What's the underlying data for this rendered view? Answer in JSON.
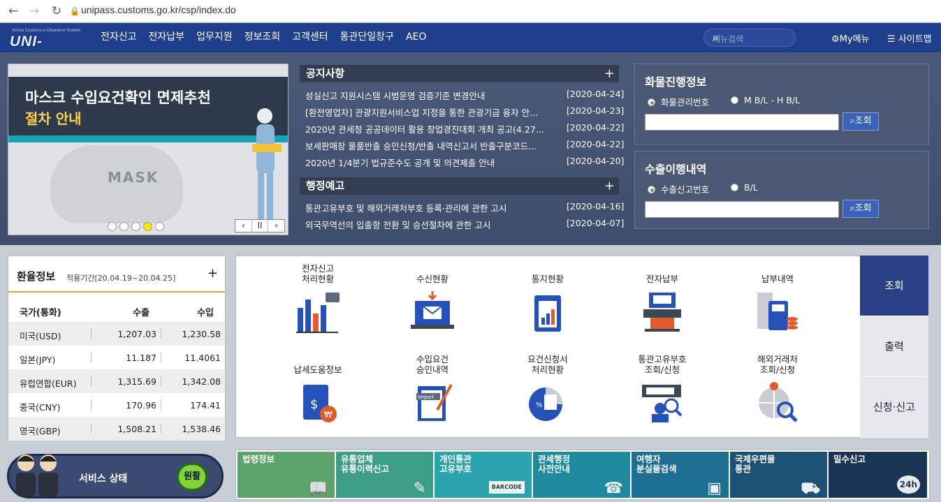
{
  "browser": {
    "url": "unipass.customs.go.kr/csp/index.do"
  },
  "header": {
    "logo_small": "Korea Customs e-Clearance System",
    "logo_text": "UNI-PASS",
    "nav": [
      "전자신고",
      "전자납부",
      "업무지원",
      "정보조회",
      "고객센터",
      "통관단일창구",
      "AEO"
    ],
    "search_placeholder": "메뉴검색",
    "mymenu": "My메뉴",
    "sitemap": "사이트맵"
  },
  "banner": {
    "line1": "마스크 수입요건확인 면제추천",
    "line2": "절차 안내",
    "mask_text": "MASK",
    "controls": [
      "‹",
      "II",
      "›"
    ]
  },
  "notices": {
    "title": "공지사항",
    "items": [
      {
        "text": "성실신고 지원시스템 시범운영 검증기준 변경안내",
        "date": "[2020-04-24]"
      },
      {
        "text": "[환전영업자] 관광지원서비스업 지정을 통한 관광기금 융자 안...",
        "date": "[2020-04-23]"
      },
      {
        "text": "2020년 관세청 공공데이터 활용 창업경진대회 개최 공고(4.27...",
        "date": "[2020-04-22]"
      },
      {
        "text": "보세판매장 물품반출 승인신청/반출 내역신고서 반출구분코드...",
        "date": "[2020-04-22]"
      },
      {
        "text": "2020년 1/4분기 법규준수도 공개 및 의견제출 안내",
        "date": "[2020-04-20]"
      }
    ]
  },
  "admin_notice": {
    "title": "행정예고",
    "items": [
      {
        "text": "통관고유부호 및 해외거래처부호 등록·관리에 관한 고시",
        "date": "[2020-04-16]"
      },
      {
        "text": "외국무역선의 입출항 전환 및 승선절차에 관한 고시",
        "date": "[2020-04-07]"
      }
    ]
  },
  "cargo": {
    "title": "화물진행정보",
    "options": [
      "화물관리번호",
      "M B/L - H B/L"
    ],
    "button": "조회"
  },
  "export": {
    "title": "수출이행내역",
    "options": [
      "수출신고번호",
      "B/L"
    ],
    "button": "조회"
  },
  "exchange": {
    "title": "환율정보",
    "period": "적용기간[20.04.19~20.04.25]",
    "headers": [
      "국가(통화)",
      "수출",
      "수입"
    ],
    "rows": [
      [
        "미국(USD)",
        "1,207.03",
        "1,230.58"
      ],
      [
        "일본(JPY)",
        "11.187",
        "11.4061"
      ],
      [
        "유럽연합(EUR)",
        "1,315.69",
        "1,342.08"
      ],
      [
        "중국(CNY)",
        "170.96",
        "174.41"
      ],
      [
        "영국(GBP)",
        "1,508.21",
        "1,538.46"
      ]
    ]
  },
  "services": [
    {
      "label": "전자신고\n처리현황",
      "icon": "bar-chart-icon"
    },
    {
      "label": "수신현황",
      "icon": "laptop-mail-icon"
    },
    {
      "label": "통지현황",
      "icon": "clipboard-chart-icon"
    },
    {
      "label": "전자납부",
      "icon": "atm-icon"
    },
    {
      "label": "납부내역",
      "icon": "receipt-calculator-icon"
    },
    {
      "label": "납세도움정보",
      "icon": "tax-book-icon"
    },
    {
      "label": "수입요건\n승인내역",
      "icon": "import-document-icon"
    },
    {
      "label": "요건신청서\n처리현황",
      "icon": "percent-pie-icon"
    },
    {
      "label": "통관고유부호\n조회/신청",
      "icon": "barcode-search-icon"
    },
    {
      "label": "해외거래처\n조회/신청",
      "icon": "globe-search-icon"
    }
  ],
  "tabs": [
    "조회",
    "출력",
    "신청·신고"
  ],
  "status": {
    "label": "서비스 상태",
    "value": "원활"
  },
  "bottom_links": [
    {
      "label": "법령정보",
      "color": "#5ba36a",
      "sym": "📖"
    },
    {
      "label": "유통업체\n유통이력신고",
      "color": "#3c9e86",
      "sym": "✎"
    },
    {
      "label": "개인통관\n고유부호",
      "color": "#2aa3ad",
      "sym": "BARCODE"
    },
    {
      "label": "관세행정\n사전안내",
      "color": "#1e8aa0",
      "sym": "☎"
    },
    {
      "label": "여행자\n분실물검색",
      "color": "#1d6f94",
      "sym": "▣"
    },
    {
      "label": "국제우편물\n통관",
      "color": "#1c5176",
      "sym": "⛟"
    },
    {
      "label": "밀수신고",
      "color": "#1a3553",
      "sym": "24h"
    }
  ]
}
